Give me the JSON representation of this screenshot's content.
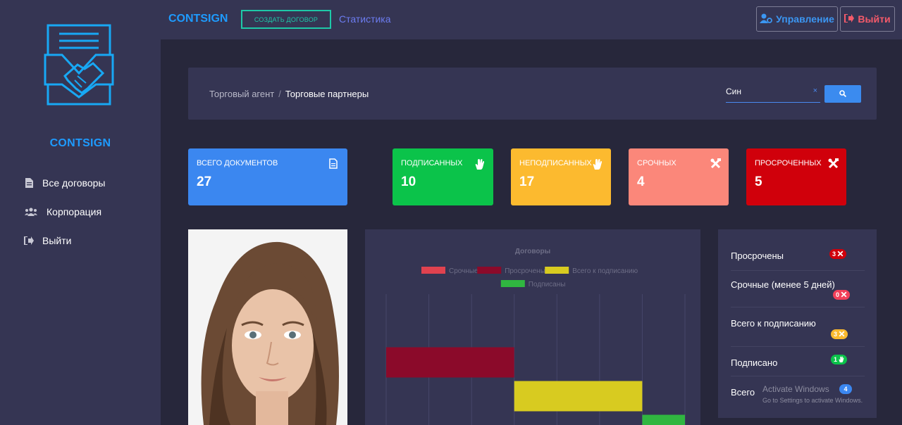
{
  "sidebar": {
    "brand": "CONTSIGN",
    "items": [
      {
        "label": "Все договоры",
        "icon": "document-icon"
      },
      {
        "label": "Корпорация",
        "icon": "users-icon"
      },
      {
        "label": "Выйти",
        "icon": "sign-out-icon"
      }
    ]
  },
  "topbar": {
    "brand": "CONTSIGN",
    "create_label": "создать договор",
    "stats_label": "Статистика",
    "management_label": "Управление",
    "logout_label": "Выйти"
  },
  "breadcrumb": {
    "parent": "Торговый агент",
    "separator": "/",
    "current": "Торговые партнеры"
  },
  "search": {
    "value": "Син",
    "clear": "×"
  },
  "stats": [
    {
      "label": "Всего документов",
      "value": "27",
      "color": "#3b87f0",
      "icon": "file-icon"
    },
    {
      "label": "Подписанных",
      "value": "10",
      "color": "#0bc34a",
      "icon": "hand-icon"
    },
    {
      "label": "Неподписанных",
      "value": "17",
      "color": "#fcba2f",
      "icon": "hand-icon"
    },
    {
      "label": "Срочных",
      "value": "4",
      "color": "#fb877a",
      "icon": "tools-icon"
    },
    {
      "label": "Просроченных",
      "value": "5",
      "color": "#d0000b",
      "icon": "tools-icon"
    }
  ],
  "chart_data": {
    "type": "bar",
    "orientation": "horizontal-floating",
    "title": "Договоры",
    "legend": [
      "Срочные",
      "Просрочены",
      "Всего к подписанию",
      "Подписаны"
    ],
    "colors": [
      "#e0424f",
      "#8b0a2a",
      "#d8cb20",
      "#30b640"
    ],
    "series": [
      {
        "name": "Срочные",
        "start": 0,
        "end": 0
      },
      {
        "name": "Просрочены",
        "start": 0,
        "end": 3
      },
      {
        "name": "Всего к подписанию",
        "start": 3,
        "end": 6
      },
      {
        "name": "Подписаны",
        "start": 6,
        "end": 7
      }
    ],
    "xlim": [
      0,
      7
    ],
    "grid": true,
    "legend_placement": "top"
  },
  "summary": [
    {
      "label": "Просрочены",
      "count": "3",
      "color": "#d0000b",
      "icon": "tools-icon"
    },
    {
      "label": "Срочные (менее 5 дней)",
      "count": "0",
      "color": "#f2405a",
      "icon": "tools-icon"
    },
    {
      "label": "Всего к подписанию",
      "count": "3",
      "color": "#fcba2f",
      "icon": "tools-icon"
    },
    {
      "label": "Подписано",
      "count": "1",
      "color": "#0bc34a",
      "icon": "hand-icon"
    },
    {
      "label": "Всего",
      "count": "4",
      "color": "#3b87f0",
      "icon": ""
    }
  ],
  "watermark": {
    "line1": "Activate Windows",
    "line2": "Go to Settings to activate Windows."
  }
}
